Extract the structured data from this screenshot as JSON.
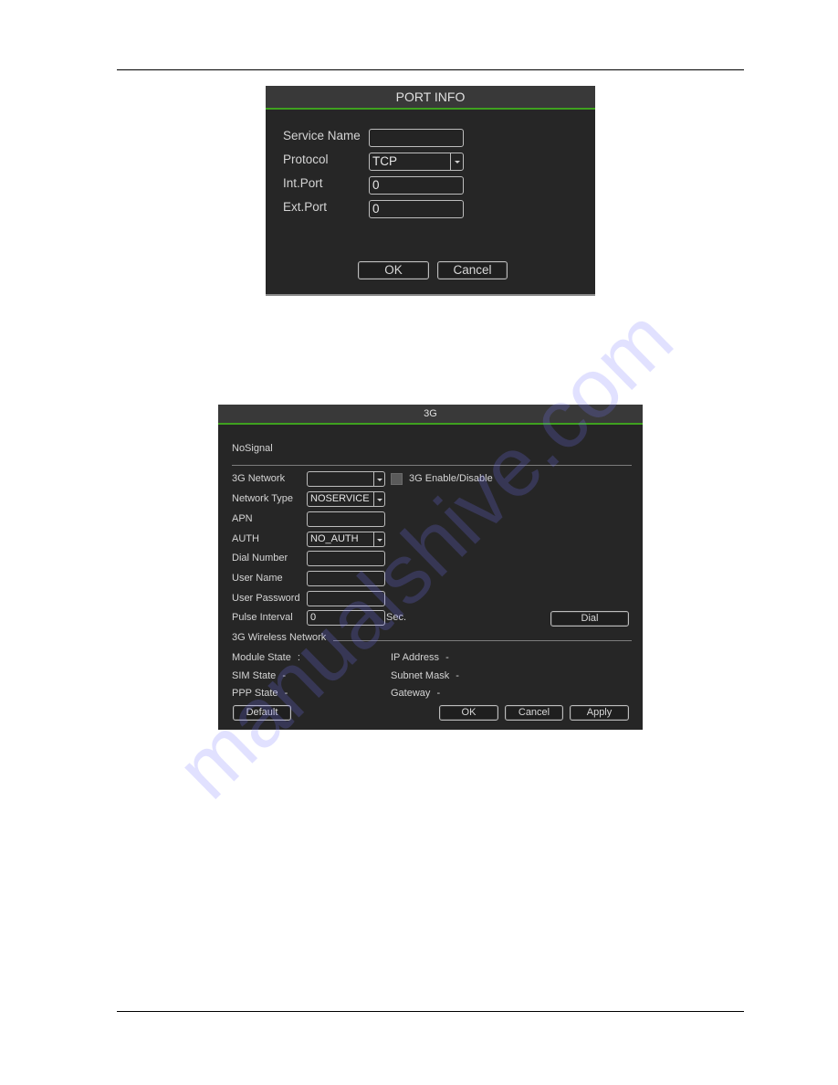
{
  "port_info": {
    "title": "PORT INFO",
    "fields": [
      {
        "label": "Service Name",
        "value": "",
        "type": "text"
      },
      {
        "label": "Protocol",
        "value": "TCP",
        "type": "select"
      },
      {
        "label": "Int.Port",
        "value": "0",
        "type": "text"
      },
      {
        "label": "Ext.Port",
        "value": "0",
        "type": "text"
      }
    ],
    "buttons": {
      "ok": "OK",
      "cancel": "Cancel"
    }
  },
  "g3": {
    "title": "3G",
    "signal_status": "NoSignal",
    "fields": [
      {
        "label": "3G Network",
        "value": "",
        "type": "select"
      },
      {
        "label": "Network Type",
        "value": "NOSERVICE",
        "type": "select"
      },
      {
        "label": "APN",
        "value": "",
        "type": "text"
      },
      {
        "label": "AUTH",
        "value": "NO_AUTH",
        "type": "select"
      },
      {
        "label": "Dial Number",
        "value": "",
        "type": "text"
      },
      {
        "label": "User Name",
        "value": "",
        "type": "text"
      },
      {
        "label": "User Password",
        "value": "",
        "type": "password"
      },
      {
        "label": "Pulse Interval",
        "value": "0",
        "type": "text"
      }
    ],
    "enable_checkbox": {
      "label": "3G Enable/Disable",
      "checked": false
    },
    "pulse_unit": "Sec.",
    "dial_button": "Dial",
    "wireless_section": "3G Wireless Network",
    "status_left": [
      {
        "label": "Module State",
        "sep": ":",
        "value": ""
      },
      {
        "label": "SIM State",
        "sep": "-",
        "value": ""
      },
      {
        "label": "PPP State",
        "sep": "-",
        "value": ""
      }
    ],
    "status_right": [
      {
        "label": "IP Address",
        "sep": "-",
        "value": ""
      },
      {
        "label": "Subnet Mask",
        "sep": "-",
        "value": ""
      },
      {
        "label": "Gateway",
        "sep": "-",
        "value": ""
      }
    ],
    "buttons": {
      "default": "Default",
      "ok": "OK",
      "cancel": "Cancel",
      "apply": "Apply"
    }
  },
  "watermark": "manualshive.com",
  "colors": {
    "accent_green": "#3fa11f",
    "dialog_bg": "#262626",
    "header_bg": "#393939"
  }
}
